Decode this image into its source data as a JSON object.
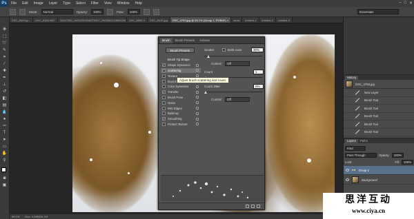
{
  "app": {
    "logo": "Ps"
  },
  "menu": [
    "File",
    "Edit",
    "Image",
    "Layer",
    "Type",
    "Select",
    "Filter",
    "View",
    "Window",
    "Help"
  ],
  "options": {
    "mode_label": "Mode:",
    "mode_value": "Normal",
    "opacity_label": "Opacity:",
    "opacity_value": "100%",
    "flow_label": "Flow:",
    "flow_value": "100%",
    "workspace": "Essentials"
  },
  "tabs": [
    {
      "label": "DSC_8409.jp...",
      "active": false
    },
    {
      "label": "DSC_8168.NEF",
      "active": false
    },
    {
      "label": "10647282_10204767818279307_2909540113861033730_n.jpg",
      "active": false
    },
    {
      "label": "DSC_8500-2",
      "active": false
    },
    {
      "label": "DSC_8419.jpg",
      "active": false
    },
    {
      "label": "DSC_4753.jpg @ 59.1% (Group 1, RGB/8*) ×",
      "active": true
    },
    {
      "label": "snow",
      "active": false
    },
    {
      "label": "Untitled-1",
      "active": false
    },
    {
      "label": "Untitled-2",
      "active": false
    },
    {
      "label": "Untitled-3",
      "active": false
    }
  ],
  "status": {
    "zoom": "59.1%",
    "doc": "Doc: 4.29M/24.1M"
  },
  "brush_panel": {
    "tabs": [
      "Brush",
      "Brush Presets",
      "Actions"
    ],
    "presets_button": "Brush Presets",
    "items": [
      {
        "label": "Brush Tip Shape",
        "header": true
      },
      {
        "label": "Shape Dynamics",
        "checked": true
      },
      {
        "label": "Scattering",
        "checked": true,
        "selected": true
      },
      {
        "label": "Texture",
        "checked": false
      },
      {
        "label": "Dual Brush",
        "checked": false
      },
      {
        "label": "Color Dynamics",
        "checked": false
      },
      {
        "label": "Transfer",
        "checked": true
      },
      {
        "label": "Brush Pose",
        "checked": false
      },
      {
        "label": "Noise",
        "checked": false
      },
      {
        "label": "Wet Edges",
        "checked": false
      },
      {
        "label": "Build-up",
        "checked": false
      },
      {
        "label": "Smoothing",
        "checked": true
      },
      {
        "label": "Protect Texture",
        "checked": false
      }
    ],
    "scatter_label": "Scatter",
    "both_axes_label": "Both Axes",
    "scatter_value": "30%",
    "control_label": "Control:",
    "control_value": "Off",
    "count_label": "Count",
    "count_value": "1",
    "count_jitter_label": "Count Jitter",
    "count_jitter_value": "0%",
    "control2_label": "Control:",
    "control2_value": "Off",
    "tooltip": "Adjust brush scattering and count."
  },
  "history": {
    "tabs": [
      "History"
    ],
    "snapshot": "DSC_4753.jpg",
    "rows": [
      "New Layer",
      "Brush Tool",
      "Brush Tool",
      "Brush Tool",
      "Brush Tool",
      "Brush Tool"
    ]
  },
  "layers": {
    "tabs": [
      "Layers",
      "Paths"
    ],
    "kind_label": "Kind",
    "blend_value": "Pass Through",
    "opacity_label": "Opacity:",
    "opacity_value": "100%",
    "lock_label": "Lock:",
    "fill_label": "Fill:",
    "fill_value": "100%",
    "rows": [
      {
        "label": "Group 1",
        "selected": true
      },
      {
        "label": "Background",
        "selected": false
      }
    ]
  },
  "watermark": {
    "line1": "思洋互动",
    "line2": "www.ciya.cn"
  }
}
